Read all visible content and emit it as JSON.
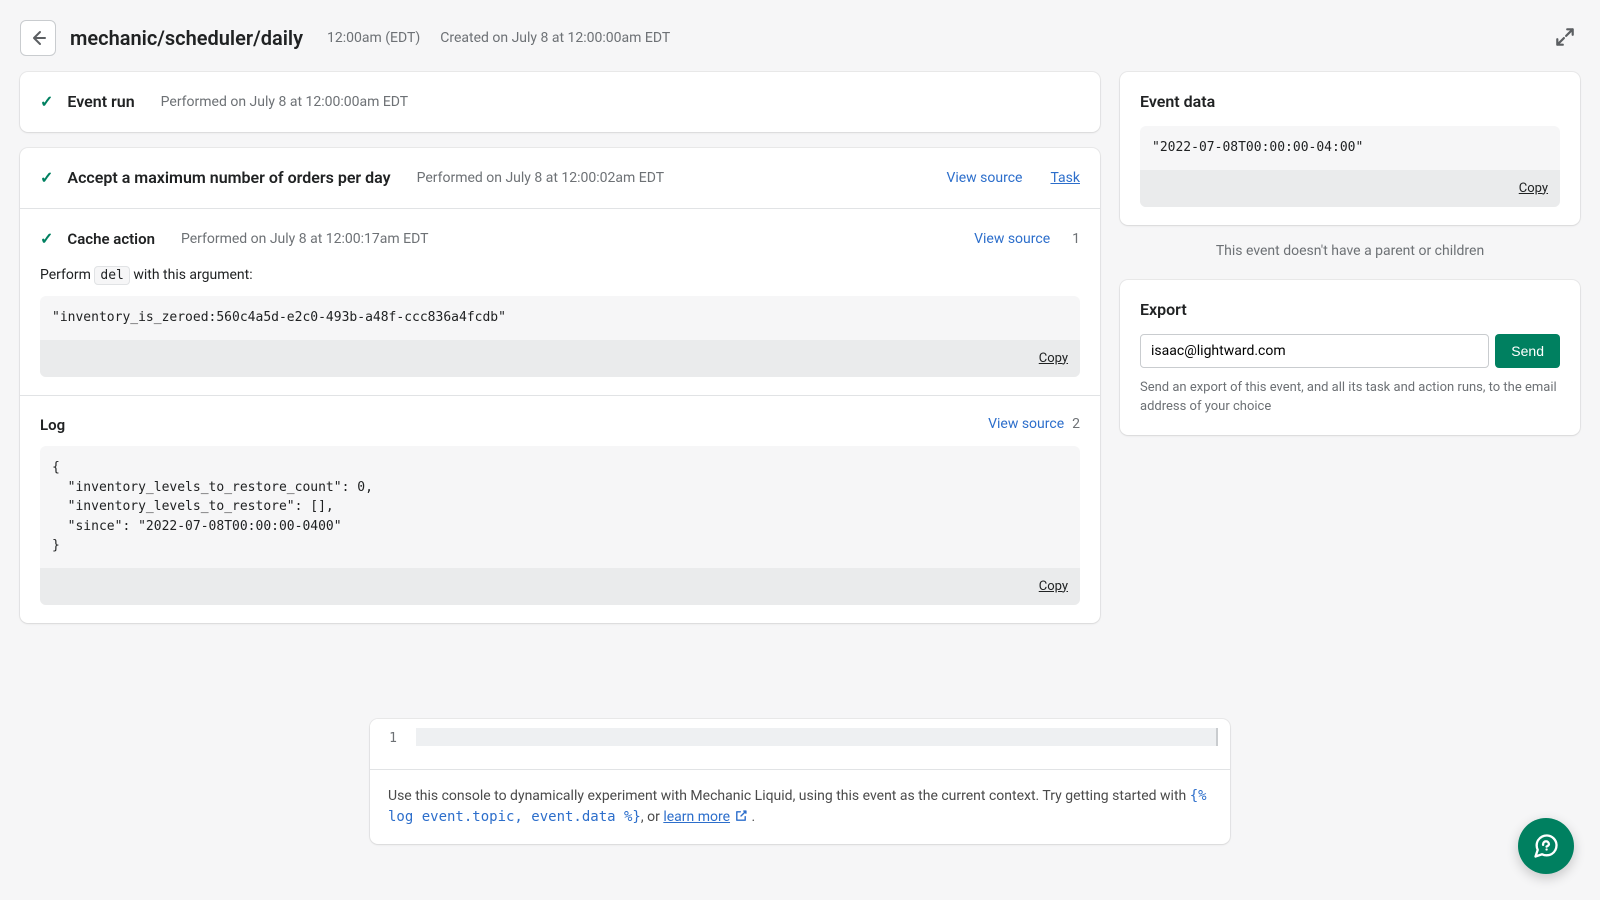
{
  "header": {
    "title": "mechanic/scheduler/daily",
    "time": "12:00am (EDT)",
    "created": "Created on July 8 at 12:00:00am EDT"
  },
  "event_run": {
    "title": "Event run",
    "performed": "Performed on July 8 at 12:00:00am EDT"
  },
  "task": {
    "title": "Accept a maximum number of orders per day",
    "performed": "Performed on July 8 at 12:00:02am EDT",
    "view_source_label": "View source",
    "task_link_label": "Task"
  },
  "cache_action": {
    "title": "Cache action",
    "performed": "Performed on July 8 at 12:00:17am EDT",
    "view_source_label": "View source",
    "index": "1",
    "perform_prefix": "Perform",
    "perform_code": "del",
    "perform_suffix": "with this argument:",
    "argument": "\"inventory_is_zeroed:560c4a5d-e2c0-493b-a48f-ccc836a4fcdb\"",
    "copy_label": "Copy"
  },
  "log": {
    "title": "Log",
    "view_source_label": "View source",
    "index": "2",
    "content": "{\n  \"inventory_levels_to_restore_count\": 0,\n  \"inventory_levels_to_restore\": [],\n  \"since\": \"2022-07-08T00:00:00-0400\"\n}",
    "copy_label": "Copy"
  },
  "event_data": {
    "heading": "Event data",
    "content": "\"2022-07-08T00:00:00-04:00\"",
    "copy_label": "Copy"
  },
  "lineage_note": "This event doesn't have a parent or children",
  "export": {
    "heading": "Export",
    "email_value": "isaac@lightward.com",
    "send_label": "Send",
    "help": "Send an export of this event, and all its task and action runs, to the email address of your choice"
  },
  "console": {
    "line_number": "1",
    "footer_prefix": "Use this console to dynamically experiment with Mechanic Liquid, using this event as the current context. Try getting started with ",
    "liquid_sample": "{% log event.topic, event.data %}",
    "footer_or": ", or ",
    "learn_more_label": "learn more",
    "footer_period": " ."
  }
}
